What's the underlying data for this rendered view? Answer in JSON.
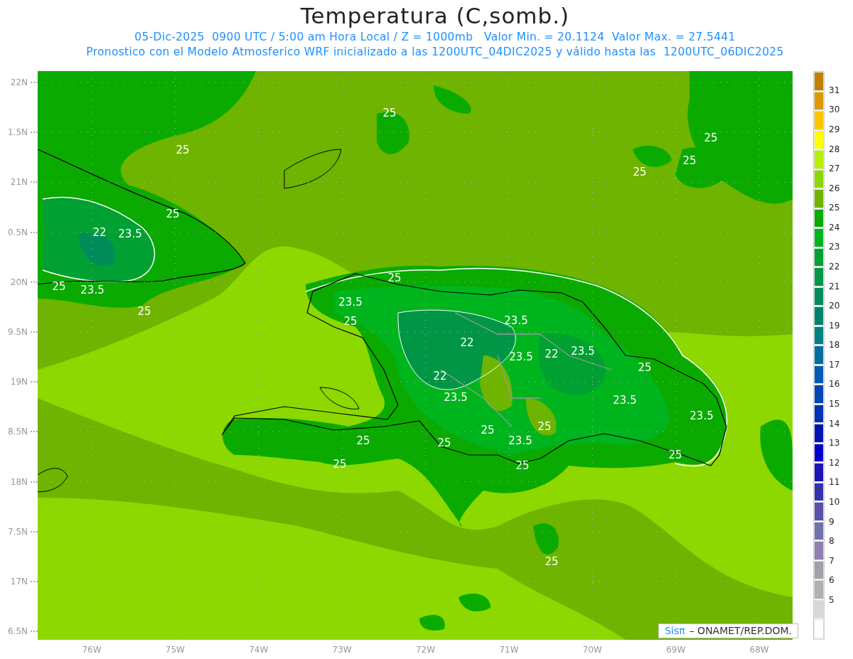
{
  "title": "Temperatura (C,somb.)",
  "subtitle_lines": [
    "05-Dic-2025  0900 UTC / 5:00 am Hora Local / Z = 1000mb   Valor Min. = 20.1124  Valor Max. = 27.5441",
    "Pronostico con el Modelo Atmosferico WRF inicializado a las 1200UTC_04DIC2025 y válido hasta las  1200UTC_06DIC2025"
  ],
  "lat_labels": [
    "22N",
    "1.5N",
    "21N",
    "0.5N",
    "20N",
    "9.5N",
    "19N",
    "8.5N",
    "18N",
    "7.5N",
    "17N",
    "6.5N"
  ],
  "lon_labels": [
    "76W",
    "75W",
    "74W",
    "73W",
    "72W",
    "71W",
    "70W",
    "69W",
    "68W"
  ],
  "contour_labels": [
    "25",
    "25",
    "22",
    "23.5",
    "23.5",
    "25",
    "25",
    "25",
    "25",
    "25",
    "25",
    "25",
    "23.5",
    "25",
    "23.5",
    "22",
    "23.5",
    "22",
    "23.5",
    "25",
    "22",
    "23.5",
    "23.5",
    "23.5",
    "25",
    "25",
    "25",
    "25",
    "23.5",
    "25",
    "25",
    "25",
    "25"
  ],
  "logo": {
    "mark": "Sisπ",
    "text": "– ONAMET/REP.DOM."
  },
  "colorbar": {
    "bins": [
      {
        "color": "#c08000"
      },
      {
        "color": "#e09800"
      },
      {
        "color": "#ffc400"
      },
      {
        "color": "#ffff00"
      },
      {
        "color": "#b4f000"
      },
      {
        "color": "#8cd800"
      },
      {
        "color": "#6eb400"
      },
      {
        "color": "#0aaa00"
      },
      {
        "color": "#00b41e"
      },
      {
        "color": "#00a032"
      },
      {
        "color": "#009646"
      },
      {
        "color": "#008c5a"
      },
      {
        "color": "#00826e"
      },
      {
        "color": "#008080"
      },
      {
        "color": "#006ea0"
      },
      {
        "color": "#005ab4"
      },
      {
        "color": "#0046b4"
      },
      {
        "color": "#0032b4"
      },
      {
        "color": "#0014b4"
      },
      {
        "color": "#0000c8"
      },
      {
        "color": "#1e14b4"
      },
      {
        "color": "#3232aa"
      },
      {
        "color": "#5a50aa"
      },
      {
        "color": "#7070aa"
      },
      {
        "color": "#9080b0"
      },
      {
        "color": "#a0a0aa"
      },
      {
        "color": "#b0b0b0"
      },
      {
        "color": "#d8d8d8"
      },
      {
        "color": "#ffffff"
      }
    ],
    "labels": [
      "31",
      "30",
      "29",
      "28",
      "27",
      "26",
      "25",
      "24",
      "23",
      "22",
      "21",
      "20",
      "19",
      "18",
      "17",
      "16",
      "15",
      "14",
      "13",
      "12",
      "11",
      "10",
      "9",
      "8",
      "7",
      "6",
      "5"
    ]
  }
}
